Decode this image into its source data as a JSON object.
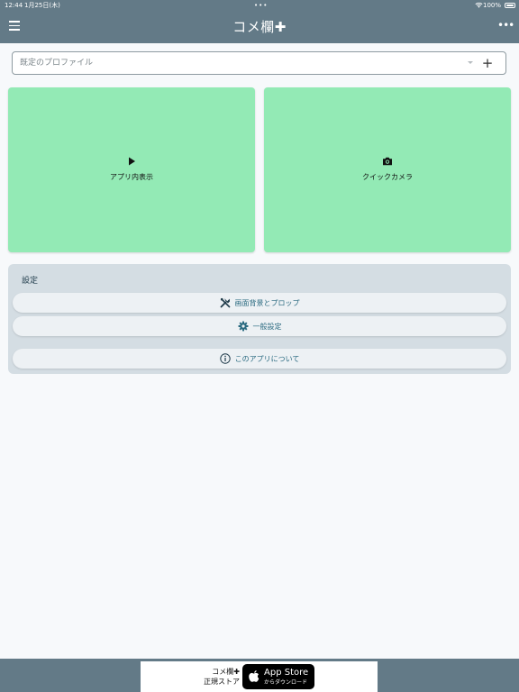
{
  "status": {
    "time": "12:44",
    "date": "1月25日(木)",
    "battery": "100%"
  },
  "app_bar": {
    "title": "コメ欄✚"
  },
  "profile": {
    "placeholder": "既定のプロファイル",
    "add_symbol": "+"
  },
  "tiles": {
    "in_app": "アプリ内表示",
    "quick_camera": "クイックカメラ"
  },
  "settings": {
    "heading": "設定",
    "items": [
      {
        "label": "画面背景とプロップ",
        "icon": "tools-icon"
      },
      {
        "label": "一般設定",
        "icon": "gear-icon"
      },
      {
        "label": "このアプリについて",
        "icon": "info-icon"
      }
    ]
  },
  "ad": {
    "line1": "コメ欄✚",
    "line2": "正規ストア",
    "store_title": "App Store",
    "store_sub": "からダウンロード"
  },
  "colors": {
    "bar": "#637a87",
    "tile": "#93eab5",
    "accent": "#2a6a80"
  }
}
